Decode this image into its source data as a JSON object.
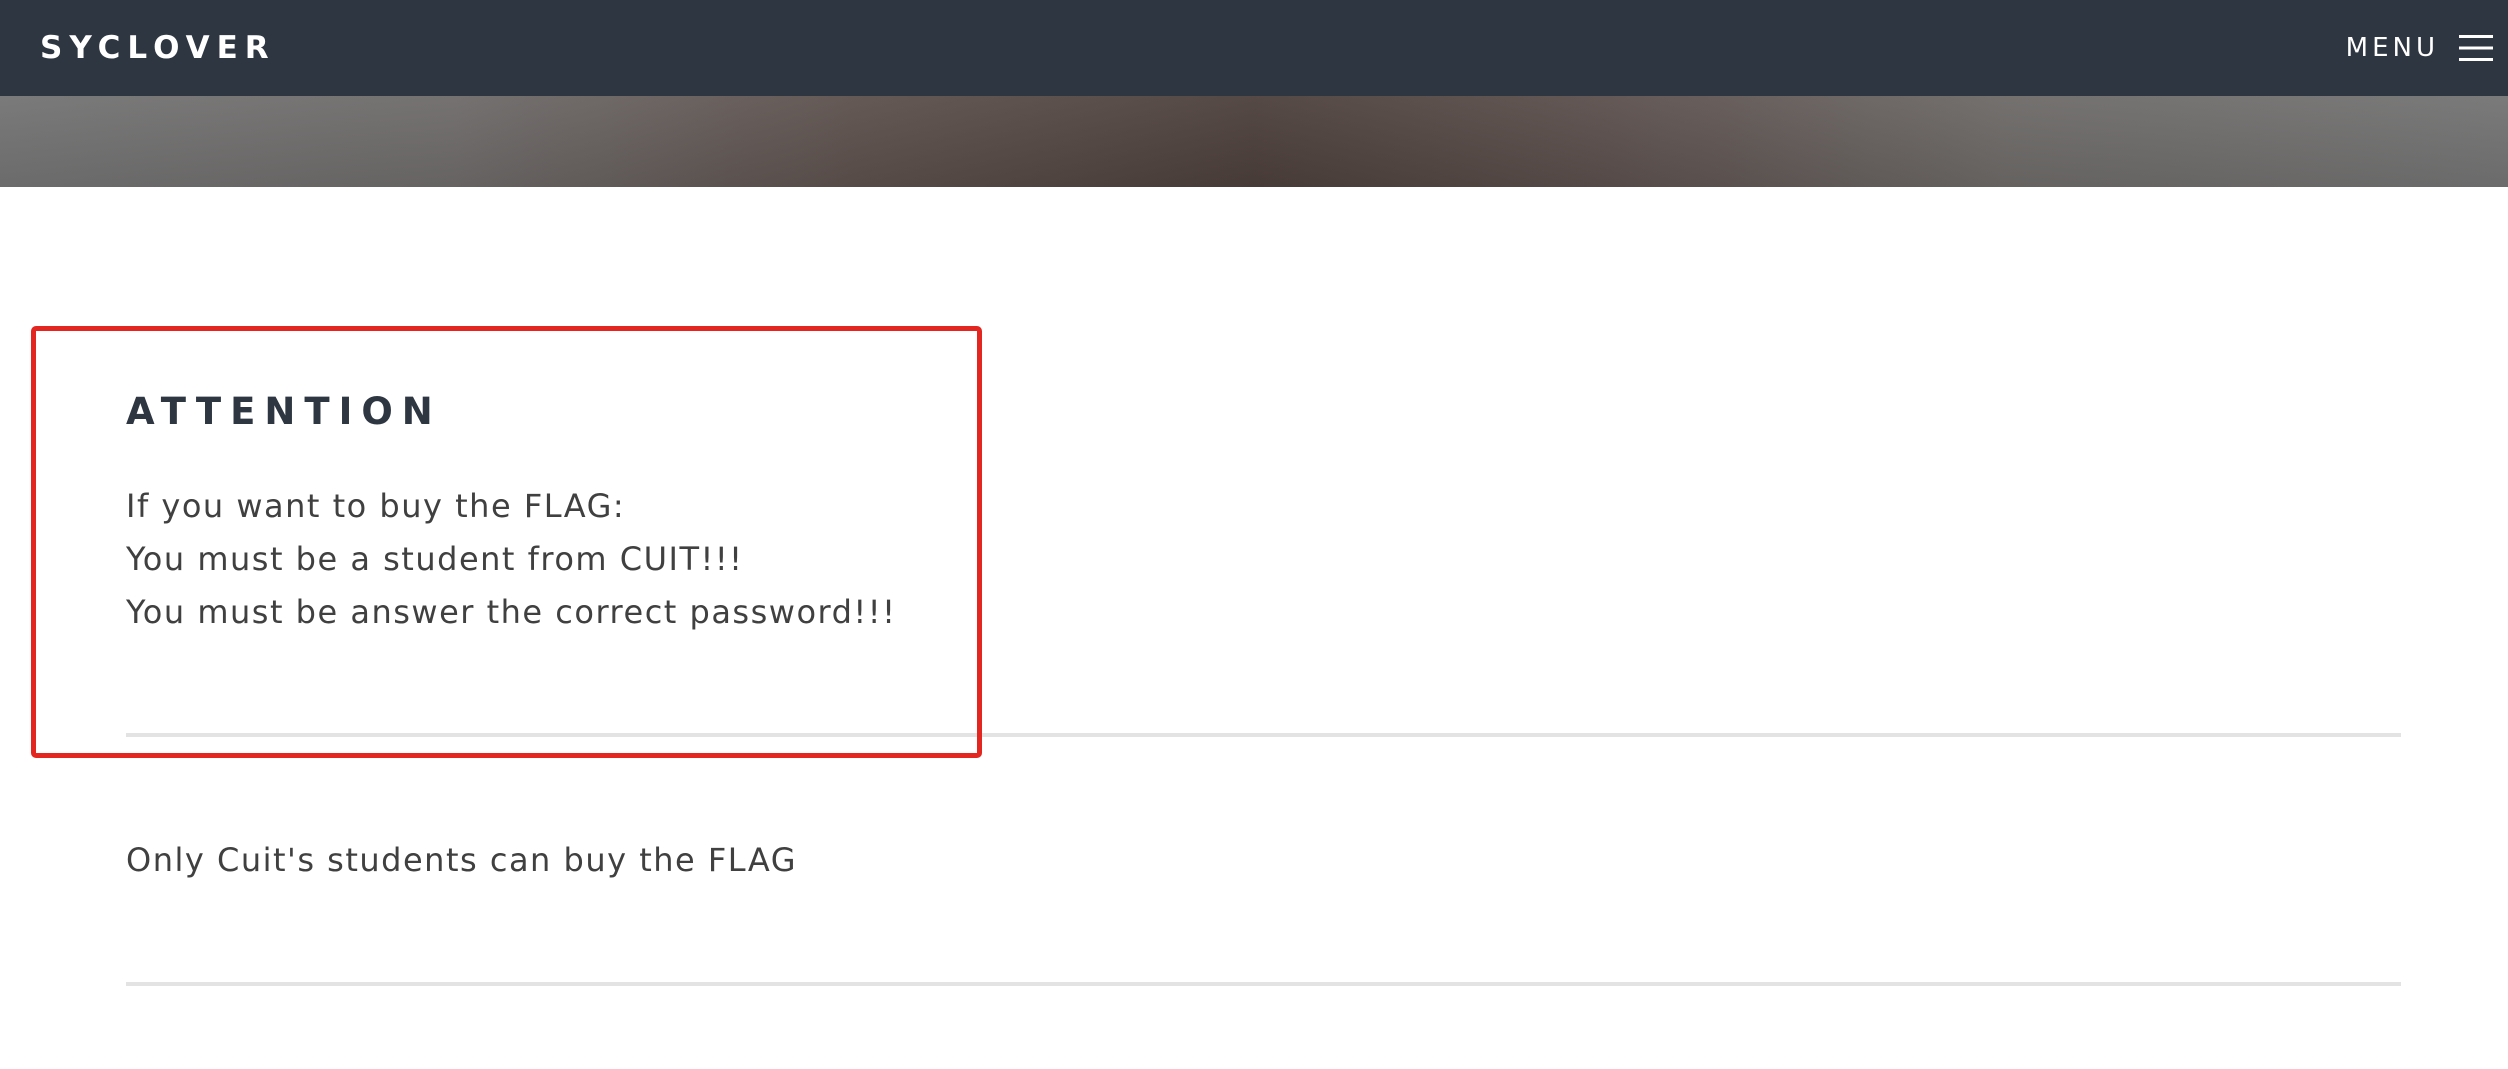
{
  "navbar": {
    "brand": "SYCLOVER",
    "menu_label": "MENU",
    "menu_icon": "hamburger-icon"
  },
  "attention": {
    "title": "ATTENTION",
    "lines": [
      "If you want to buy the FLAG:",
      "You must be a student from CUIT!!!",
      "You must be answer the correct password!!!"
    ]
  },
  "notice": {
    "text": "Only Cuit's students can buy the FLAG"
  },
  "colors": {
    "navbar_background": "#2d3641",
    "highlight_border": "#e32620",
    "divider": "#e3e3e3",
    "body_text": "#404040",
    "title_text": "#2d3641"
  }
}
